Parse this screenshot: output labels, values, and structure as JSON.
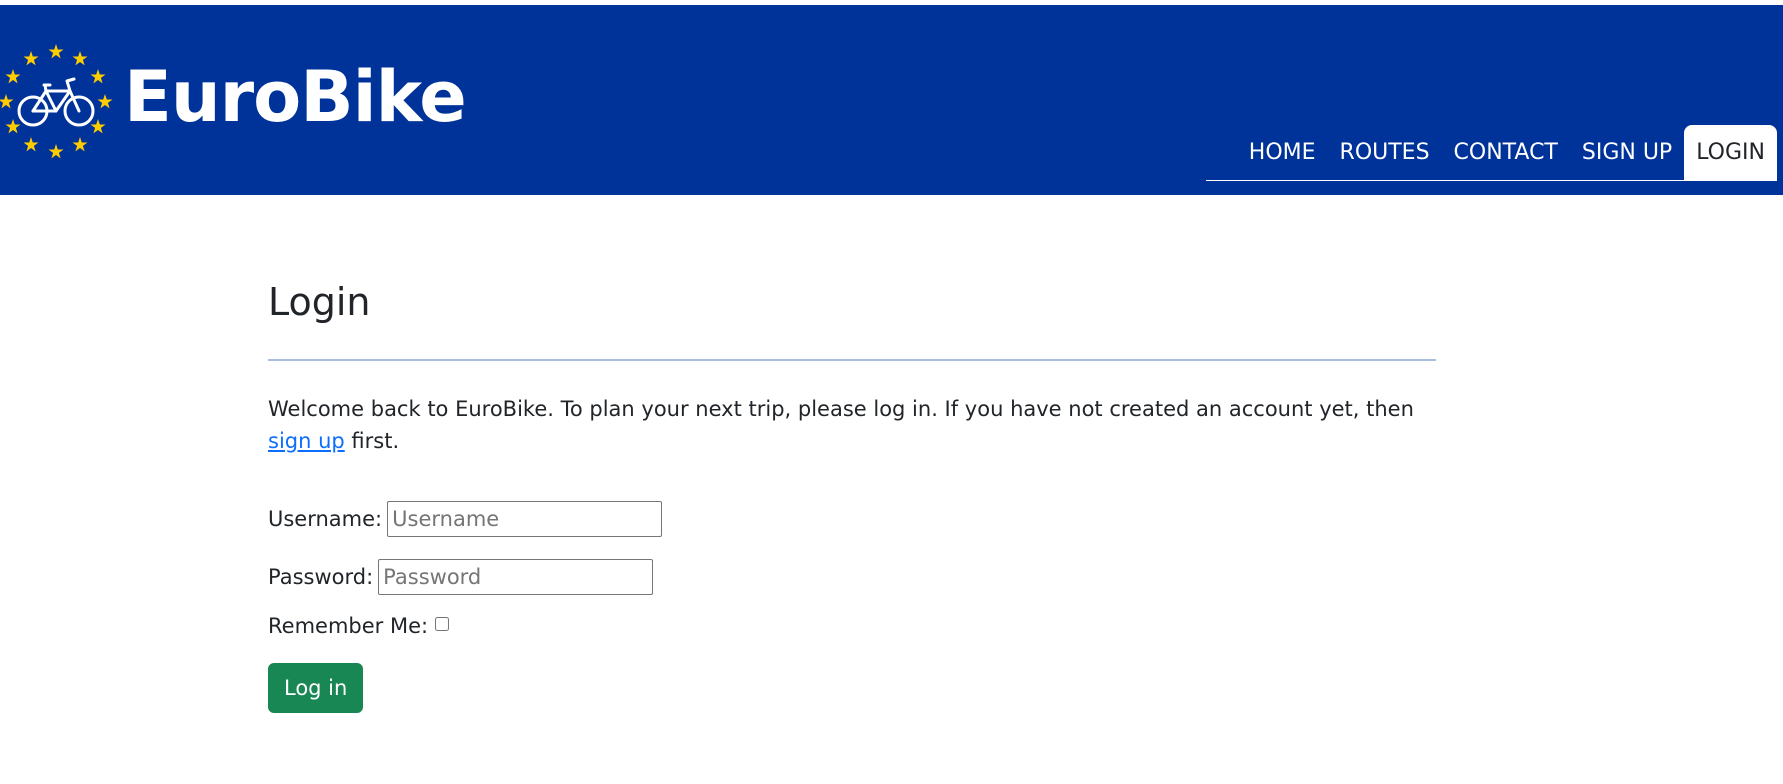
{
  "header": {
    "brand": "EuroBike",
    "logo_icon": "bicycle-in-eu-stars-icon",
    "colors": {
      "background": "#003399",
      "stars": "#FFCC00",
      "text": "#ffffff"
    }
  },
  "nav": {
    "items": [
      {
        "label": "HOME",
        "active": false
      },
      {
        "label": "ROUTES",
        "active": false
      },
      {
        "label": "CONTACT",
        "active": false
      },
      {
        "label": "SIGN UP",
        "active": false
      },
      {
        "label": "LOGIN",
        "active": true
      }
    ]
  },
  "main": {
    "title": "Login",
    "intro_text": "Welcome back to EuroBike. To plan your next trip, please log in. If you have not created an account yet, then ",
    "signup_link": "sign up",
    "intro_suffix": " first.",
    "form": {
      "username_label": "Username:",
      "username_placeholder": "Username",
      "username_value": "",
      "password_label": "Password:",
      "password_placeholder": "Password",
      "password_value": "",
      "remember_label": "Remember Me:",
      "remember_checked": false,
      "submit_label": "Log in"
    },
    "colors": {
      "link": "#0d6efd",
      "button": "#198754",
      "divider": "#a9bde0"
    }
  }
}
